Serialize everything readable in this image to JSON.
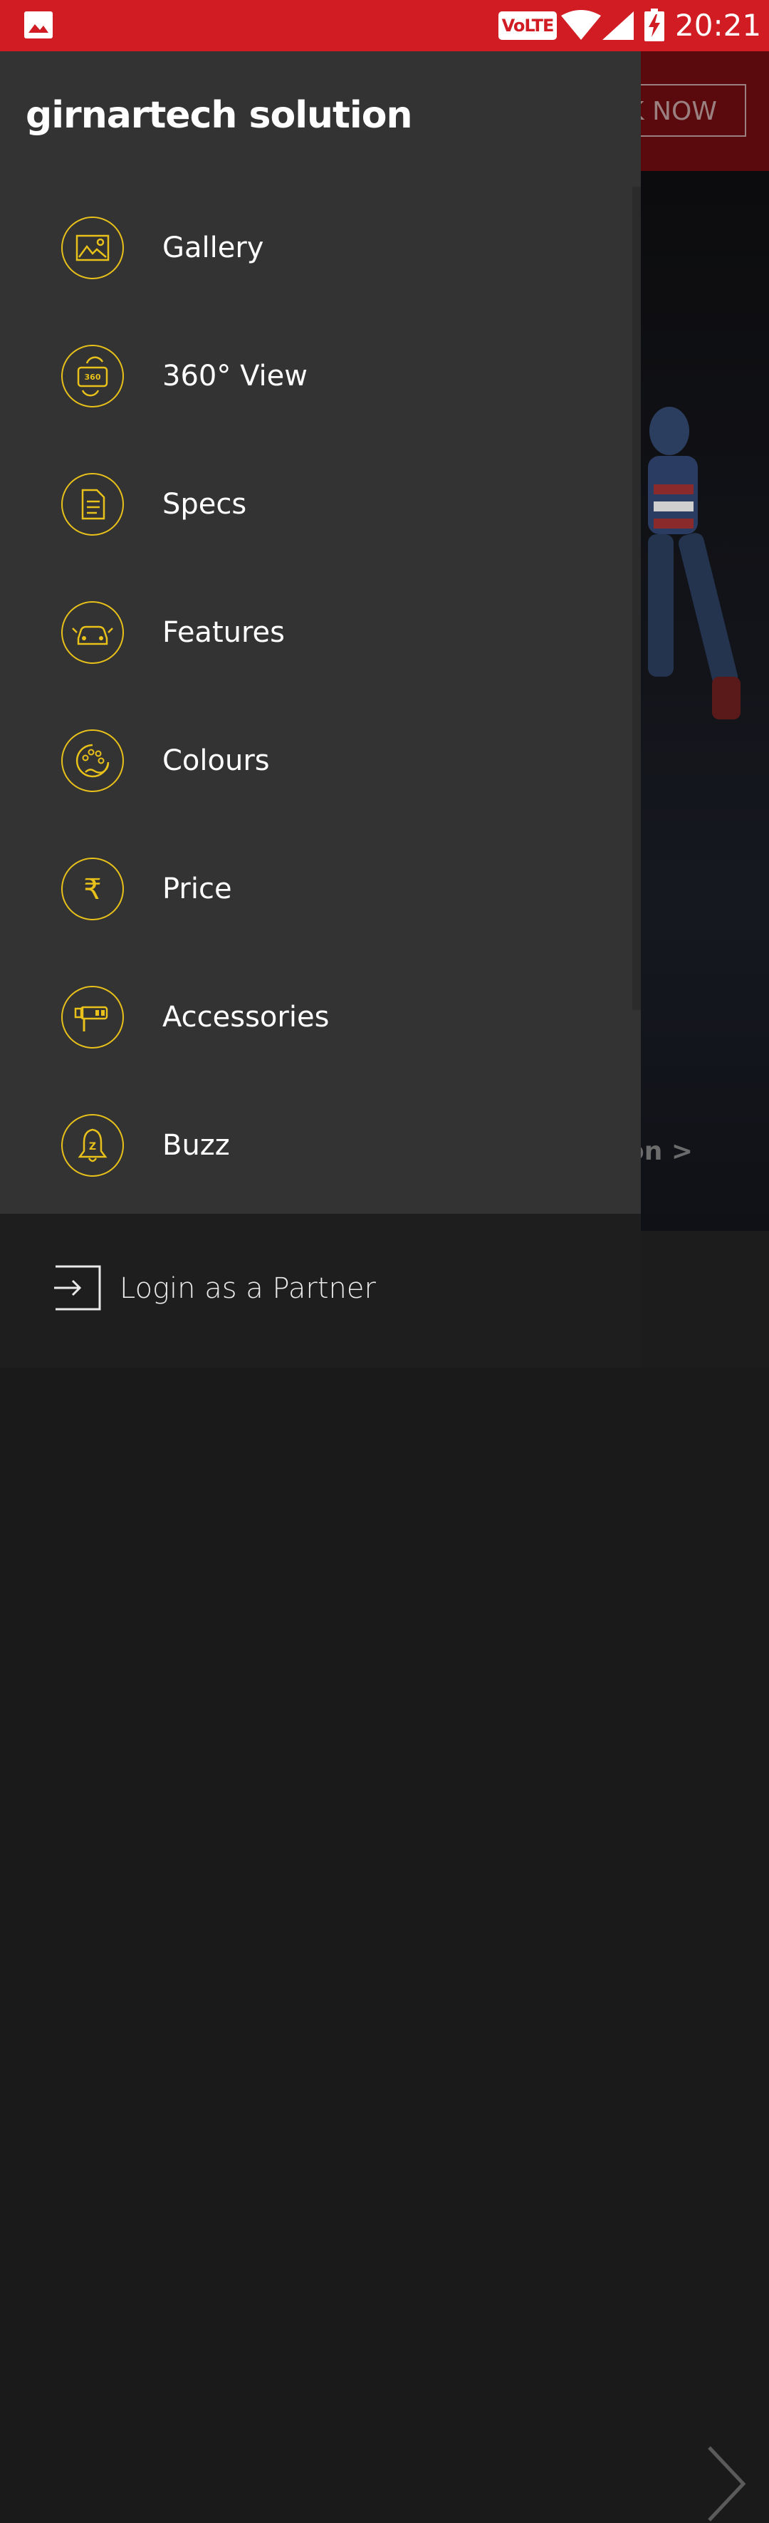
{
  "status_bar": {
    "time": "20:21",
    "volte": "VoLTE",
    "icons": [
      "gallery-icon",
      "volte-icon",
      "wifi-icon",
      "signal-icon",
      "battery-charging-icon"
    ]
  },
  "background_app": {
    "book_now": "K NOW",
    "hero_link": "on >"
  },
  "drawer": {
    "title": "girnartech solution",
    "items": [
      {
        "label": "Gallery",
        "icon": "gallery-icon"
      },
      {
        "label": "360° View",
        "icon": "360-view-icon"
      },
      {
        "label": "Specs",
        "icon": "specs-document-icon"
      },
      {
        "label": "Features",
        "icon": "car-features-icon"
      },
      {
        "label": "Colours",
        "icon": "palette-icon"
      },
      {
        "label": "Price",
        "icon": "rupee-icon"
      },
      {
        "label": "Accessories",
        "icon": "key-accessories-icon"
      },
      {
        "label": "Buzz",
        "icon": "bell-icon"
      }
    ],
    "footer": {
      "label": "Login as a Partner",
      "icon": "login-icon"
    },
    "accent_color": "#e8c11a",
    "background_color": "#333333"
  },
  "colors": {
    "status_bar": "#d01c22",
    "header_bg": "#5a0a0c"
  }
}
